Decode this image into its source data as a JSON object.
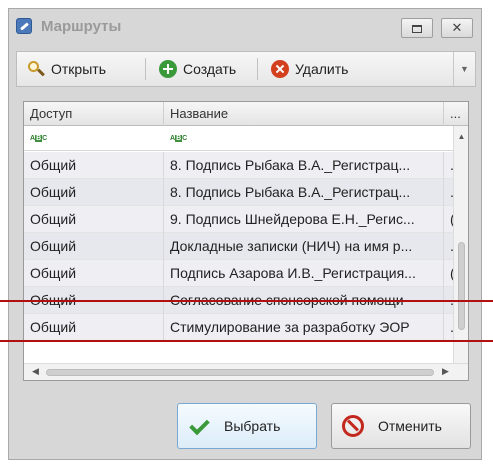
{
  "window": {
    "title": "Маршруты"
  },
  "toolbar": {
    "open_label": "Открыть",
    "create_label": "Создать",
    "delete_label": "Удалить"
  },
  "grid": {
    "columns": [
      "Доступ",
      "Название",
      "..."
    ],
    "rows": [
      {
        "access": "Общий",
        "name": "8. Подпись Рыбака В.А._Регистрац...",
        "extra": "..."
      },
      {
        "access": "Общий",
        "name": "8. Подпись Рыбака В.А._Регистрац...",
        "extra": "..."
      },
      {
        "access": "Общий",
        "name": "9. Подпись Шнейдерова Е.Н._Регис...",
        "extra": "(."
      },
      {
        "access": "Общий",
        "name": "Докладные записки (НИЧ) на имя р...",
        "extra": "..."
      },
      {
        "access": "Общий",
        "name": "Подпись Азарова И.В._Регистрация...",
        "extra": "(."
      },
      {
        "access": "Общий",
        "name": "Согласование спонсорской помощи",
        "extra": "..."
      },
      {
        "access": "Общий",
        "name": "Стимулирование за разработку ЭОР",
        "extra": "..."
      }
    ]
  },
  "buttons": {
    "select_label": "Выбрать",
    "cancel_label": "Отменить"
  },
  "colors": {
    "highlight_line": "#b01010",
    "accent_select": "#7aa8d4"
  }
}
